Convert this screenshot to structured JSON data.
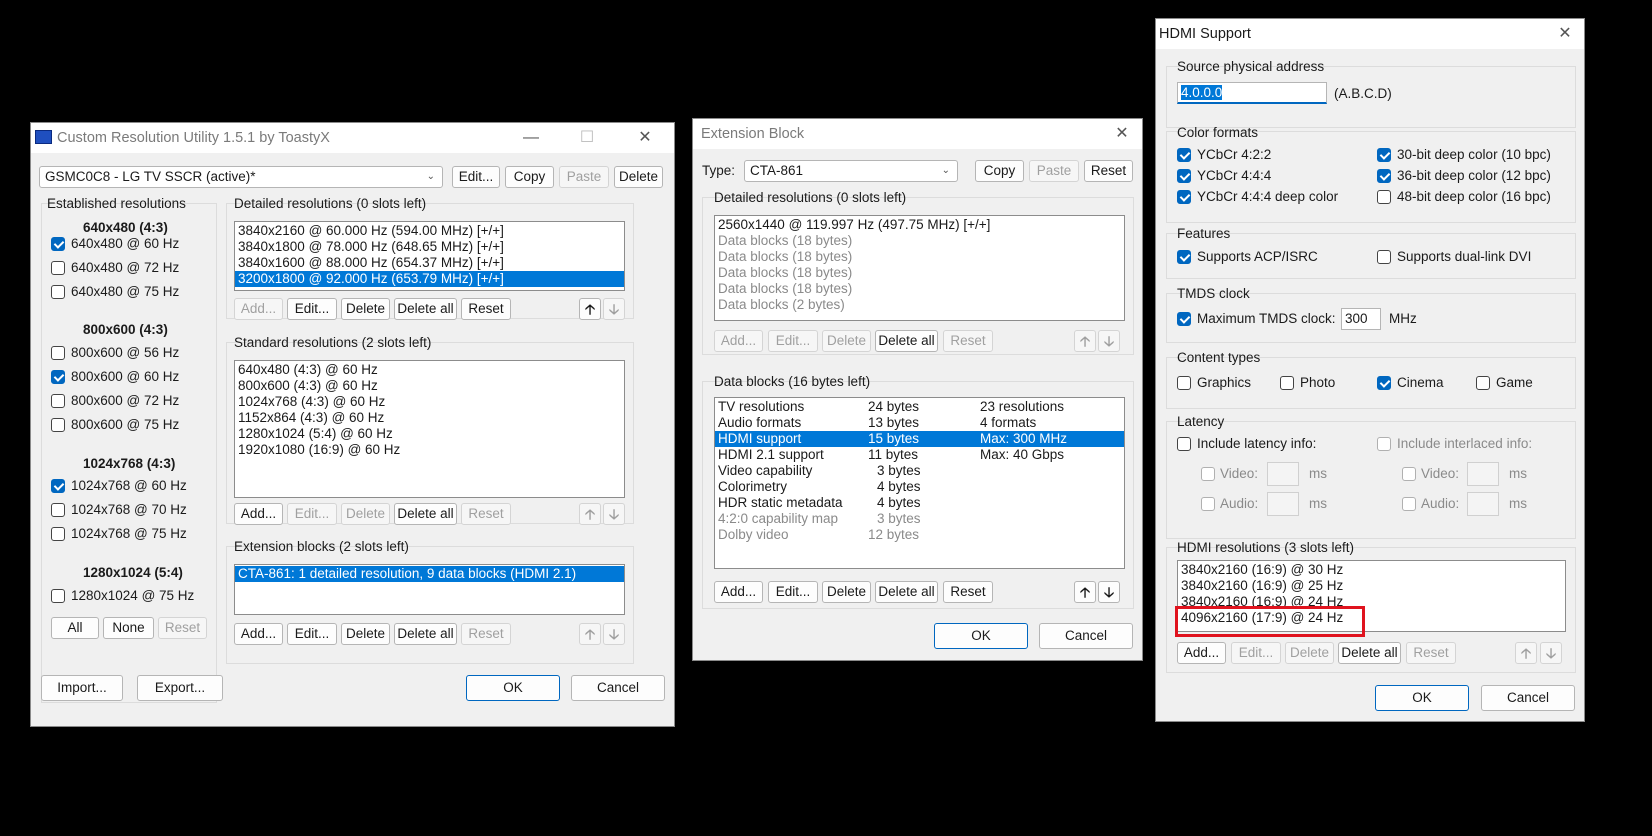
{
  "cru": {
    "title": "Custom Resolution Utility 1.5.1 by ToastyX",
    "monitor": "GSMC0C8 - LG TV SSCR (active)*",
    "top_buttons": [
      "Edit...",
      "Copy",
      "Paste",
      "Delete"
    ],
    "established": {
      "label": "Established resolutions",
      "groups": [
        {
          "heading": "640x480 (4:3)",
          "items": [
            {
              "label": "640x480 @ 60 Hz",
              "checked": true
            },
            {
              "label": "640x480 @ 72 Hz",
              "checked": false
            },
            {
              "label": "640x480 @ 75 Hz",
              "checked": false
            }
          ]
        },
        {
          "heading": "800x600 (4:3)",
          "items": [
            {
              "label": "800x600 @ 56 Hz",
              "checked": false
            },
            {
              "label": "800x600 @ 60 Hz",
              "checked": true
            },
            {
              "label": "800x600 @ 72 Hz",
              "checked": false
            },
            {
              "label": "800x600 @ 75 Hz",
              "checked": false
            }
          ]
        },
        {
          "heading": "1024x768 (4:3)",
          "items": [
            {
              "label": "1024x768 @ 60 Hz",
              "checked": true
            },
            {
              "label": "1024x768 @ 70 Hz",
              "checked": false
            },
            {
              "label": "1024x768 @ 75 Hz",
              "checked": false
            }
          ]
        },
        {
          "heading": "1280x1024 (5:4)",
          "items": [
            {
              "label": "1280x1024 @ 75 Hz",
              "checked": false
            }
          ]
        }
      ],
      "buttons": [
        "All",
        "None",
        "Reset"
      ]
    },
    "detailed": {
      "label": "Detailed resolutions (0 slots left)",
      "rows": [
        "3840x2160 @ 60.000 Hz (594.00 MHz) [+/+]",
        "3840x1800 @ 78.000 Hz (648.65 MHz) [+/+]",
        "3840x1600 @ 88.000 Hz (654.37 MHz) [+/+]",
        "3200x1800 @ 92.000 Hz (653.79 MHz) [+/+]"
      ],
      "selected": 3,
      "buttons": [
        "Add...",
        "Edit...",
        "Delete",
        "Delete all",
        "Reset"
      ]
    },
    "standard": {
      "label": "Standard resolutions (2 slots left)",
      "rows": [
        "640x480 (4:3) @ 60 Hz",
        "800x600 (4:3) @ 60 Hz",
        "1024x768 (4:3) @ 60 Hz",
        "1152x864 (4:3) @ 60 Hz",
        "1280x1024 (5:4) @ 60 Hz",
        "1920x1080 (16:9) @ 60 Hz"
      ],
      "buttons": [
        "Add...",
        "Edit...",
        "Delete",
        "Delete all",
        "Reset"
      ]
    },
    "extension": {
      "label": "Extension blocks (2 slots left)",
      "rows": [
        "CTA-861: 1 detailed resolution, 9 data blocks (HDMI 2.1)"
      ],
      "buttons": [
        "Add...",
        "Edit...",
        "Delete",
        "Delete all",
        "Reset"
      ]
    },
    "import": "Import...",
    "export": "Export...",
    "ok": "OK",
    "cancel": "Cancel"
  },
  "ext": {
    "title": "Extension Block",
    "type_label": "Type:",
    "type_value": "CTA-861",
    "top_buttons": [
      "Copy",
      "Paste",
      "Reset"
    ],
    "detailed": {
      "label": "Detailed resolutions (0 slots left)",
      "rows": [
        "2560x1440 @ 119.997 Hz (497.75 MHz) [+/+]",
        "Data blocks (18 bytes)",
        "Data blocks (18 bytes)",
        "Data blocks (18 bytes)",
        "Data blocks (18 bytes)",
        "Data blocks (2 bytes)"
      ],
      "buttons": [
        "Add...",
        "Edit...",
        "Delete",
        "Delete all",
        "Reset"
      ]
    },
    "data_blocks": {
      "label": "Data blocks (16 bytes left)",
      "rows": [
        {
          "name": "TV resolutions",
          "size": "24 bytes",
          "info": "23 resolutions"
        },
        {
          "name": "Audio formats",
          "size": "13 bytes",
          "info": "4 formats"
        },
        {
          "name": "HDMI support",
          "size": "15 bytes",
          "info": "Max: 300 MHz"
        },
        {
          "name": "HDMI 2.1 support",
          "size": "11 bytes",
          "info": "Max: 40 Gbps"
        },
        {
          "name": "Video capability",
          "size": "3 bytes",
          "info": ""
        },
        {
          "name": "Colorimetry",
          "size": "4 bytes",
          "info": ""
        },
        {
          "name": "HDR static metadata",
          "size": "4 bytes",
          "info": ""
        },
        {
          "name": "4:2:0 capability map",
          "size": "3 bytes",
          "info": ""
        },
        {
          "name": "Dolby video",
          "size": "12 bytes",
          "info": ""
        }
      ],
      "selected": 2,
      "buttons": [
        "Add...",
        "Edit...",
        "Delete",
        "Delete all",
        "Reset"
      ]
    },
    "ok": "OK",
    "cancel": "Cancel"
  },
  "hdmi": {
    "title": "HDMI Support",
    "source": {
      "label": "Source physical address",
      "value": "4.0.0.0",
      "suffix": "(A.B.C.D)"
    },
    "color": {
      "label": "Color formats",
      "items": [
        {
          "label": "YCbCr 4:2:2",
          "checked": true
        },
        {
          "label": "YCbCr 4:4:4",
          "checked": true
        },
        {
          "label": "YCbCr 4:4:4 deep color",
          "checked": true
        },
        {
          "label": "30-bit deep color (10 bpc)",
          "checked": true
        },
        {
          "label": "36-bit deep color (12 bpc)",
          "checked": true
        },
        {
          "label": "48-bit deep color (16 bpc)",
          "checked": false
        }
      ]
    },
    "features": {
      "label": "Features",
      "items": [
        {
          "label": "Supports ACP/ISRC",
          "checked": true
        },
        {
          "label": "Supports dual-link DVI",
          "checked": false
        }
      ]
    },
    "tmds": {
      "label": "TMDS clock",
      "check_label": "Maximum TMDS clock:",
      "checked": true,
      "value": "300",
      "unit": "MHz"
    },
    "content": {
      "label": "Content types",
      "items": [
        {
          "label": "Graphics",
          "checked": false
        },
        {
          "label": "Photo",
          "checked": false
        },
        {
          "label": "Cinema",
          "checked": true
        },
        {
          "label": "Game",
          "checked": false
        }
      ]
    },
    "latency": {
      "label": "Latency",
      "include": "Include latency info:",
      "include_interlaced": "Include interlaced info:",
      "video": "Video:",
      "audio": "Audio:",
      "ms": "ms"
    },
    "resolutions": {
      "label": "HDMI resolutions (3 slots left)",
      "rows": [
        "3840x2160 (16:9) @ 30 Hz",
        "3840x2160 (16:9) @ 25 Hz",
        "3840x2160 (16:9) @ 24 Hz",
        "4096x2160 (17:9) @ 24 Hz"
      ],
      "buttons": [
        "Add...",
        "Edit...",
        "Delete",
        "Delete all",
        "Reset"
      ]
    },
    "ok": "OK",
    "cancel": "Cancel"
  }
}
